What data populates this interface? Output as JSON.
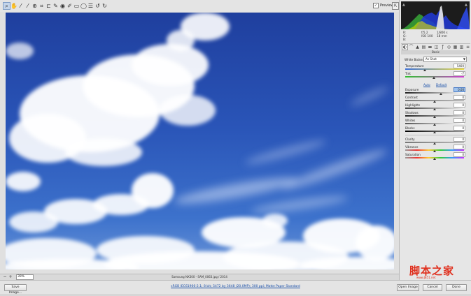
{
  "toolbar": {
    "tools": [
      "zoom-icon",
      "hand-icon",
      "white-balance-icon",
      "color-sampler-icon",
      "targeted-adjust-icon",
      "crop-icon",
      "straighten-icon",
      "spot-removal-icon",
      "red-eye-icon",
      "adjustment-brush-icon",
      "graduated-filter-icon",
      "radial-filter-icon",
      "preferences-icon",
      "rotate-ccw-icon",
      "rotate-cw-icon"
    ],
    "preview_label": "Preview",
    "preview_checked": "✓"
  },
  "histogram": {
    "readout_rgb": [
      "R:",
      "G:",
      "B:"
    ],
    "readout_exposure": "f/5.2",
    "readout_shutter": "1/800 s",
    "readout_iso": "ISO 100",
    "readout_focal": "18 mm"
  },
  "panel": {
    "section_title": "Basic",
    "white_balance_label": "White Balance:",
    "white_balance_value": "As Shot",
    "auto_label": "Auto",
    "default_label": "Default",
    "controls": [
      {
        "label": "Temperature",
        "value": "5400"
      },
      {
        "label": "Tint",
        "value": "-7"
      },
      {
        "label": "Exposure",
        "value": "0.00"
      },
      {
        "label": "Contrast",
        "value": "0"
      },
      {
        "label": "Highlights",
        "value": "0"
      },
      {
        "label": "Shadows",
        "value": "0"
      },
      {
        "label": "Whites",
        "value": "0"
      },
      {
        "label": "Blacks",
        "value": "0"
      },
      {
        "label": "Clarity",
        "value": "0"
      },
      {
        "label": "Vibrance",
        "value": "0"
      },
      {
        "label": "Saturation",
        "value": "0"
      }
    ]
  },
  "status": {
    "zoom": "39%",
    "filename": "Samsung NX300 - SAM_0063.jpg / 2014"
  },
  "bottom": {
    "save_label": "Save Image...",
    "workflow_label": "sRGB IEC61966-2.1; 8 bit; 5472 by 3648 (20.0MP); 300 ppi; Matte Paper Standard",
    "open_label": "Open Image",
    "cancel_label": "Cancel",
    "done_label": "Done"
  },
  "watermark": {
    "main": "脚本之家",
    "sub": "www.JB51.net"
  },
  "colors": {
    "sky_top": "#1f3f9e",
    "sky_bottom": "#6b95d8",
    "link": "#1a4fa8",
    "watermark": "#e0301e"
  }
}
